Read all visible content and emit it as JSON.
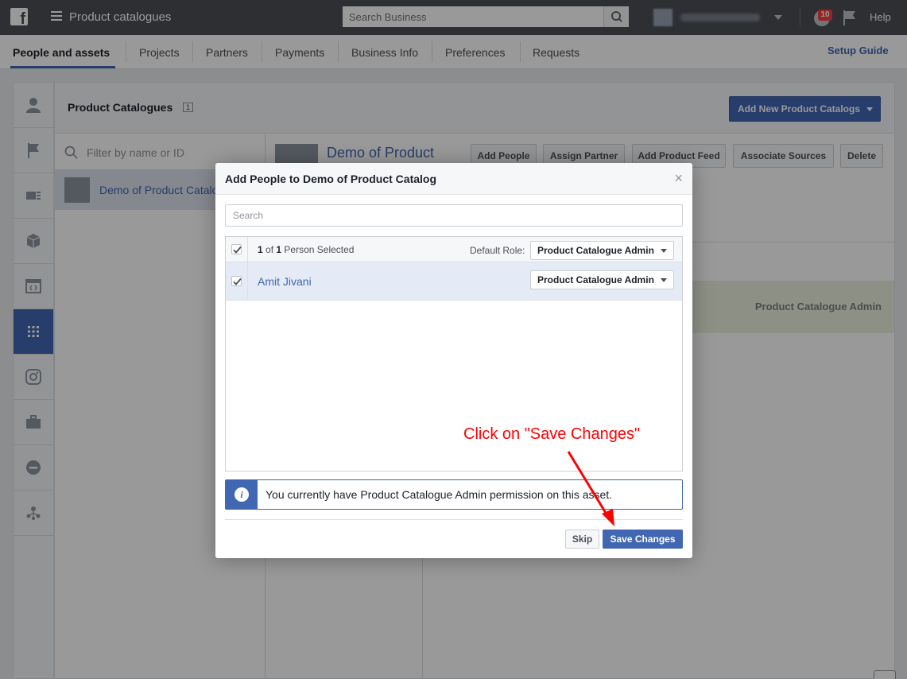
{
  "topbar": {
    "logo": "f",
    "title": "Product catalogues",
    "search_placeholder": "Search Business",
    "notification_count": "10",
    "help_label": "Help"
  },
  "nav": {
    "tabs": [
      {
        "label": "People and assets"
      },
      {
        "label": "Projects"
      },
      {
        "label": "Partners"
      },
      {
        "label": "Payments"
      },
      {
        "label": "Business Info"
      },
      {
        "label": "Preferences"
      },
      {
        "label": "Requests"
      }
    ],
    "setup_guide": "Setup Guide"
  },
  "sidebar_icons": [
    "person-icon",
    "flag-icon",
    "page-icon",
    "cube-icon",
    "code-icon",
    "grid-icon",
    "instagram-icon",
    "briefcase-icon",
    "block-icon",
    "network-icon"
  ],
  "panel": {
    "title": "Product Catalogues",
    "count": "1",
    "add_button": "Add New Product Catalogs",
    "filter_placeholder": "Filter by name or ID",
    "catalog_item": "Demo of Product Catalog",
    "asset_title": "Demo of Product",
    "actions": [
      "Add People",
      "Assign Partner",
      "Add Product Feed",
      "Associate Sources",
      "Delete"
    ],
    "role_label": "Product Catalogue Admin"
  },
  "modal": {
    "title": "Add People to Demo of Product Catalog",
    "close": "×",
    "search_placeholder": "Search",
    "selected_count": "1",
    "selected_total": "1",
    "selected_suffix": "Person Selected",
    "selected_of": "of",
    "default_role_label": "Default Role:",
    "default_role_value": "Product Catalogue Admin",
    "person_name": "Amit Jivani",
    "person_role": "Product Catalogue Admin",
    "info_text": "You currently have Product Catalogue Admin permission on this asset.",
    "skip": "Skip",
    "save": "Save Changes"
  },
  "annotation": "Click on \"Save Changes\"",
  "colors": {
    "brand": "#4267b2",
    "annotation": "#ff0000",
    "topbar": "#4b4f56"
  }
}
